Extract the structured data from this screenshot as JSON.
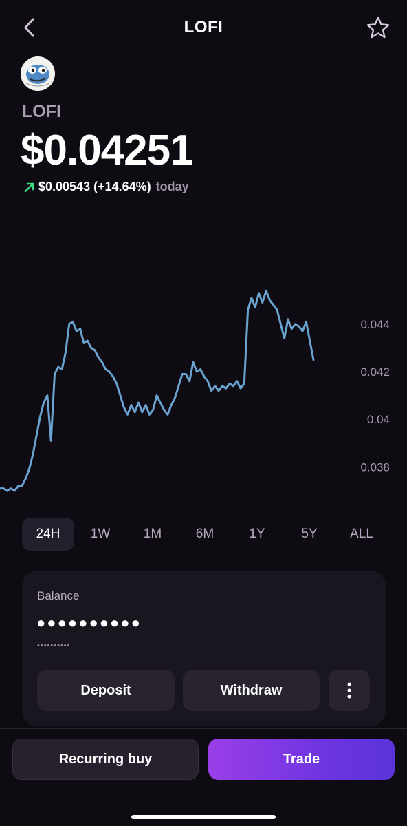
{
  "header": {
    "title": "LOFI",
    "back_icon": "chevron-left-icon",
    "favorite_icon": "star-outline-icon"
  },
  "asset": {
    "ticker": "LOFI",
    "avatar_icon": "pepe-token-logo",
    "price": "$0.04251",
    "change_value": "$0.00543 (+14.64%)",
    "change_period": "today",
    "change_icon": "arrow-up-right-icon",
    "change_color": "#3ddc84"
  },
  "chart_data": {
    "type": "line",
    "y_ticks": [
      "0.044",
      "0.042",
      "0.04",
      "0.038"
    ],
    "ylim": [
      0.0368,
      0.0472
    ],
    "line_color": "#6aa3cf",
    "grid": false,
    "x": [
      0,
      1,
      2,
      3,
      4,
      5,
      6,
      7,
      8,
      9,
      10,
      11,
      12,
      13,
      14,
      15,
      16,
      17,
      18,
      19,
      20,
      21,
      22,
      23,
      24,
      25,
      26,
      27,
      28,
      29,
      30,
      31,
      32,
      33,
      34,
      35,
      36,
      37,
      38,
      39,
      40,
      41,
      42,
      43,
      44,
      45,
      46,
      47,
      48,
      49,
      50,
      51,
      52,
      53,
      54,
      55,
      56,
      57,
      58,
      59,
      60,
      61,
      62,
      63,
      64,
      65,
      66,
      67,
      68,
      69,
      70,
      71,
      72,
      73,
      74,
      75,
      76,
      77,
      78,
      79,
      80,
      81,
      82,
      83,
      84,
      85,
      86,
      87,
      88,
      89,
      90,
      91,
      92,
      93,
      94,
      95,
      96,
      97,
      98,
      99
    ],
    "values": [
      0.0371,
      0.0371,
      0.037,
      0.0371,
      0.037,
      0.0372,
      0.0372,
      0.0375,
      0.0379,
      0.0385,
      0.0393,
      0.0401,
      0.0407,
      0.041,
      0.0391,
      0.0419,
      0.0422,
      0.0421,
      0.0428,
      0.044,
      0.0441,
      0.0437,
      0.0438,
      0.0432,
      0.0433,
      0.043,
      0.0429,
      0.0426,
      0.0424,
      0.0421,
      0.042,
      0.0418,
      0.0415,
      0.041,
      0.0405,
      0.0402,
      0.0406,
      0.0403,
      0.0407,
      0.0403,
      0.0406,
      0.0402,
      0.0404,
      0.041,
      0.0407,
      0.0404,
      0.0402,
      0.0406,
      0.0409,
      0.0414,
      0.0419,
      0.0419,
      0.0416,
      0.0424,
      0.042,
      0.0421,
      0.0418,
      0.0416,
      0.0412,
      0.0414,
      0.0412,
      0.0414,
      0.0413,
      0.0415,
      0.0414,
      0.0416,
      0.0413,
      0.0415,
      0.0446,
      0.0451,
      0.0447,
      0.0453,
      0.0449,
      0.0454,
      0.045,
      0.0448,
      0.0446,
      0.044,
      0.0434,
      0.0442,
      0.0438,
      0.044,
      0.0439,
      0.0437,
      0.0441,
      0.0433,
      0.0425
    ],
    "range_selected": "24H"
  },
  "ranges": [
    "24H",
    "1W",
    "1M",
    "6M",
    "1Y",
    "5Y",
    "ALL"
  ],
  "balance": {
    "label": "Balance",
    "value": "●●●●●●●●●●",
    "sub_value": "••••••••••",
    "deposit_label": "Deposit",
    "withdraw_label": "Withdraw",
    "more_icon": "more-vertical-icon"
  },
  "actions": {
    "recurring_label": "Recurring buy",
    "trade_label": "Trade"
  }
}
